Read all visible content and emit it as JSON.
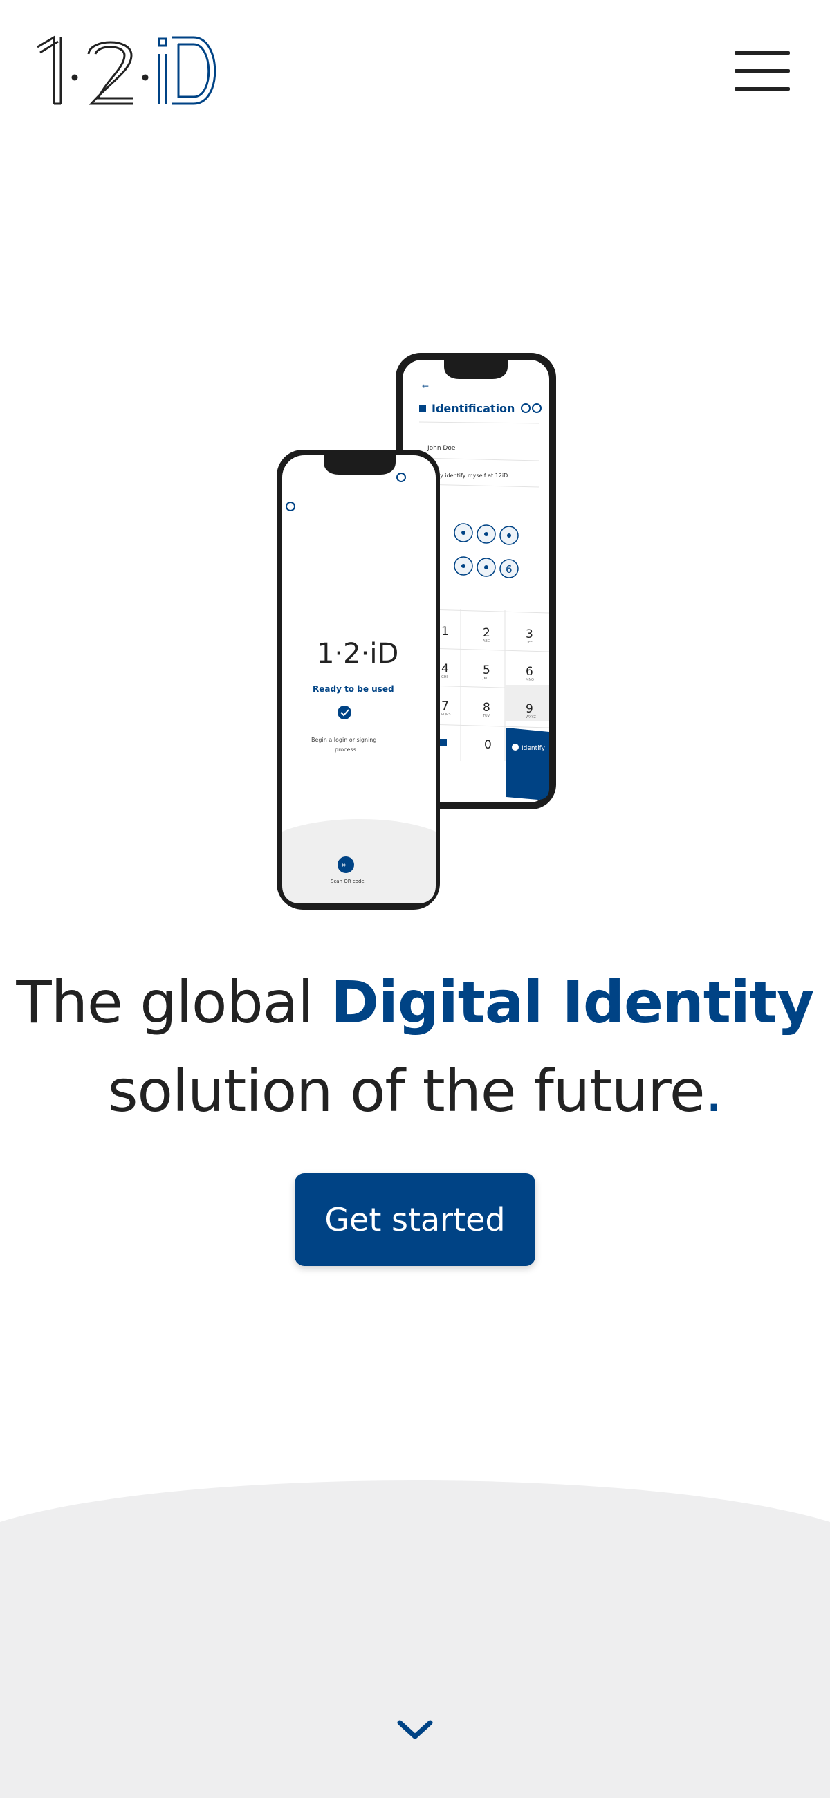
{
  "header": {
    "logo_text": "1·2·iD",
    "logo_icon": "brand-logo",
    "menu_icon": "hamburger-menu-icon"
  },
  "hero": {
    "headline_part1": "The global ",
    "headline_highlight": "Digital Identity",
    "headline_part2": "solution of the future",
    "headline_period": ".",
    "cta_label": "Get started",
    "scroll_icon": "chevron-down-icon"
  },
  "phone_front": {
    "logo_text": "1·2·iD",
    "status_title": "Ready to be used",
    "message_line1": "Begin a login or signing",
    "message_line2": "process.",
    "scan_label": "Scan QR code"
  },
  "phone_back": {
    "title": "Identification",
    "user_name": "John Doe",
    "statement": "I hereby identify myself at 12iD.",
    "pin_last_digit": "6",
    "keys": [
      {
        "num": "1",
        "letters": ""
      },
      {
        "num": "2",
        "letters": "ABC"
      },
      {
        "num": "3",
        "letters": "DEF"
      },
      {
        "num": "4",
        "letters": "GHI"
      },
      {
        "num": "5",
        "letters": "JKL"
      },
      {
        "num": "6",
        "letters": "MNO"
      },
      {
        "num": "7",
        "letters": "PQRS"
      },
      {
        "num": "8",
        "letters": "TUV"
      },
      {
        "num": "9",
        "letters": "WXYZ"
      }
    ],
    "zero_key": "0",
    "identify_label": "Identify"
  },
  "colors": {
    "brand_blue": "#004385",
    "text_dark": "#222222",
    "band_gray": "#eeeeef"
  }
}
